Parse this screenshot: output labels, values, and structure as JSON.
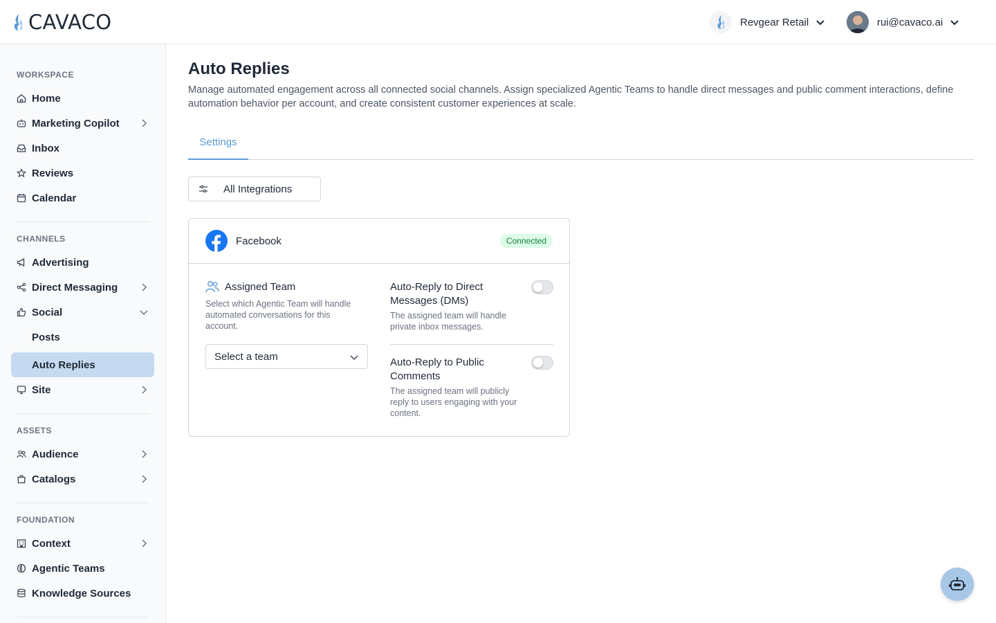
{
  "header": {
    "logo_text": "CAVACO",
    "org_name": "Revgear Retail",
    "user_email": "rui@cavaco.ai"
  },
  "sidebar": {
    "sections": {
      "workspace": "WORKSPACE",
      "channels": "CHANNELS",
      "assets": "ASSETS",
      "foundation": "FOUNDATION"
    },
    "items": {
      "home": "Home",
      "marketing_copilot": "Marketing Copilot",
      "inbox": "Inbox",
      "reviews": "Reviews",
      "calendar": "Calendar",
      "advertising": "Advertising",
      "direct_messaging": "Direct Messaging",
      "social": "Social",
      "posts": "Posts",
      "auto_replies": "Auto Replies",
      "site": "Site",
      "audience": "Audience",
      "catalogs": "Catalogs",
      "context": "Context",
      "agentic_teams": "Agentic Teams",
      "knowledge_sources": "Knowledge Sources"
    }
  },
  "main": {
    "title": "Auto Replies",
    "description": "Manage automated engagement across all connected social channels. Assign specialized Agentic Teams to handle direct messages and public comment interactions, define automation behavior per account, and create consistent customer experiences at scale.",
    "tabs": {
      "settings": "Settings"
    },
    "filter_label": "All Integrations",
    "card": {
      "title": "Facebook",
      "status": "Connected",
      "team_title": "Assigned Team",
      "team_desc": "Select which Agentic Team will handle automated conversations for this account.",
      "select_placeholder": "Select a team",
      "dm_title": "Auto-Reply to Direct Messages (DMs)",
      "dm_desc": "The assigned team will handle private inbox messages.",
      "dm_enabled": false,
      "comments_title": "Auto-Reply to Public Comments",
      "comments_desc": "The assigned team will publicly reply to users engaging with your content.",
      "comments_enabled": false
    }
  },
  "colors": {
    "accent": "#5b9bd5",
    "active_nav": "#c5daf0",
    "badge_bg": "#dcfce7",
    "badge_text": "#15803d",
    "facebook": "#1877f2"
  }
}
